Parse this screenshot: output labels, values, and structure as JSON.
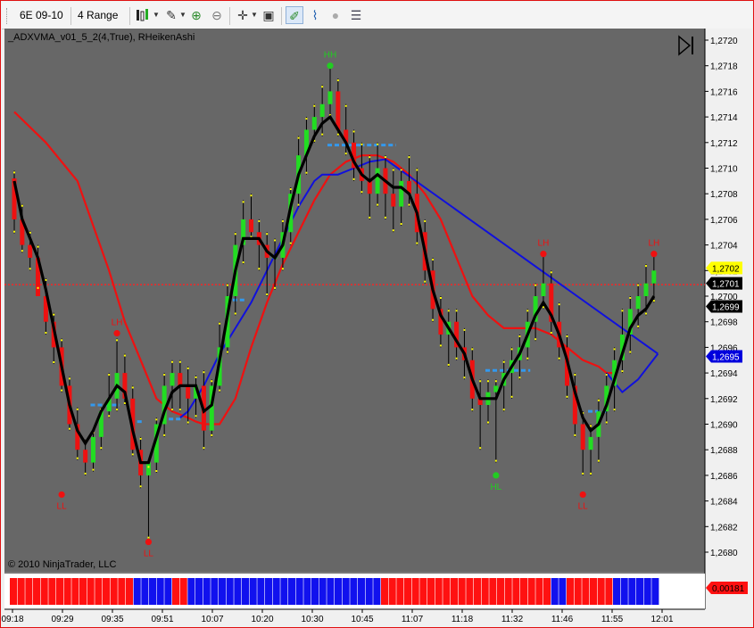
{
  "toolbar": {
    "instrument": "6E 09-10",
    "bar_type": "4 Range",
    "icons": [
      "bar-style-icon",
      "draw-tool-icon",
      "zoom-in-icon",
      "zoom-out-icon",
      "crosshair-icon",
      "properties-icon",
      "chart-trader-icon",
      "indicator-icon",
      "record-icon",
      "data-box-icon"
    ]
  },
  "chart_header": "_ADXVMA_v01_5_2(4,True), RHeikenAshi",
  "copyright": "© 2010 NinjaTrader, LLC",
  "colors": {
    "background": "#676767",
    "up_bar": "#22dd22",
    "down_bar": "#ee1111",
    "adxvma": "#000000",
    "slow_ma": "#ee1111",
    "fast_ma": "#1010dd",
    "dashes": "#3399ee",
    "reference_line": "#ff2222"
  },
  "chart_data": {
    "type": "candlestick",
    "y_axis_ticks": [
      "1,2720",
      "1,2718",
      "1,2716",
      "1,2714",
      "1,2712",
      "1,2710",
      "1,2708",
      "1,2706",
      "1,2704",
      "1,2702",
      "1,2700",
      "1,2698",
      "1,2696",
      "1,2694",
      "1,2692",
      "1,2690",
      "1,2688",
      "1,2686",
      "1,2684",
      "1,2682",
      "1,2680"
    ],
    "ylim": [
      1.2679,
      1.2721
    ],
    "x_axis_ticks": [
      "09:18",
      "09:29",
      "09:35",
      "09:51",
      "10:07",
      "10:20",
      "10:30",
      "10:45",
      "11:07",
      "11:18",
      "11:32",
      "11:46",
      "11:55",
      "12:01"
    ],
    "price_markers": [
      {
        "label": "1,2702",
        "value": 1.27022,
        "color": "#ffff00"
      },
      {
        "label": "1,2701",
        "value": 1.2701,
        "color": "#000000"
      },
      {
        "label": "1,2699",
        "value": 1.26992,
        "color": "#000000"
      },
      {
        "label": "1,2695",
        "value": 1.26953,
        "color": "#0000dd"
      }
    ],
    "reference_line": 1.27009,
    "swing_labels": [
      {
        "text": "LL",
        "bar": 6,
        "value": 1.26845,
        "color": "red",
        "pos": "below"
      },
      {
        "text": "LH",
        "bar": 13,
        "value": 1.26971,
        "color": "red",
        "pos": "above"
      },
      {
        "text": "LL",
        "bar": 17,
        "value": 1.26808,
        "color": "red",
        "pos": "below"
      },
      {
        "text": "HH",
        "bar": 40,
        "value": 1.2718,
        "color": "green",
        "pos": "above"
      },
      {
        "text": "HL",
        "bar": 61,
        "value": 1.2686,
        "color": "green",
        "pos": "below"
      },
      {
        "text": "LH",
        "bar": 67,
        "value": 1.27033,
        "color": "red",
        "pos": "above"
      },
      {
        "text": "LL",
        "bar": 72,
        "value": 1.26845,
        "color": "red",
        "pos": "below"
      },
      {
        "text": "LH",
        "bar": 81,
        "value": 1.27033,
        "color": "red",
        "pos": "above"
      }
    ],
    "candles": [
      [
        1.27092,
        1.27098,
        1.27049,
        1.2706
      ],
      [
        1.2706,
        1.27072,
        1.27034,
        1.2704
      ],
      [
        1.2704,
        1.27051,
        1.2702,
        1.2703
      ],
      [
        1.2703,
        1.2704,
        1.27005,
        1.27
      ],
      [
        1.27,
        1.27014,
        1.2697,
        1.2698
      ],
      [
        1.2698,
        1.26987,
        1.26947,
        1.2696
      ],
      [
        1.2696,
        1.26967,
        1.26925,
        1.2693
      ],
      [
        1.2693,
        1.26937,
        1.26895,
        1.269
      ],
      [
        1.269,
        1.26913,
        1.26872,
        1.2688
      ],
      [
        1.2688,
        1.26888,
        1.2686,
        1.2687
      ],
      [
        1.2687,
        1.26895,
        1.26863,
        1.2689
      ],
      [
        1.2689,
        1.26913,
        1.2688,
        1.2691
      ],
      [
        1.2691,
        1.2694,
        1.26905,
        1.2692
      ],
      [
        1.2692,
        1.26967,
        1.2691,
        1.2694
      ],
      [
        1.2694,
        1.26955,
        1.26915,
        1.2692
      ],
      [
        1.2692,
        1.2693,
        1.26875,
        1.2688
      ],
      [
        1.2688,
        1.2689,
        1.2685,
        1.2686
      ],
      [
        1.2686,
        1.26868,
        1.2681,
        1.2687
      ],
      [
        1.2687,
        1.26905,
        1.26862,
        1.269
      ],
      [
        1.269,
        1.2694,
        1.2689,
        1.2693
      ],
      [
        1.2693,
        1.2695,
        1.2691,
        1.2694
      ],
      [
        1.2694,
        1.2695,
        1.2691,
        1.2693
      ],
      [
        1.2693,
        1.26945,
        1.269,
        1.2692
      ],
      [
        1.2692,
        1.26938,
        1.26905,
        1.2693
      ],
      [
        1.2693,
        1.26942,
        1.2688,
        1.26895
      ],
      [
        1.26895,
        1.26935,
        1.2689,
        1.2693
      ],
      [
        1.2693,
        1.2698,
        1.26925,
        1.2696
      ],
      [
        1.2696,
        1.2701,
        1.26955,
        1.27
      ],
      [
        1.27,
        1.2705,
        1.26985,
        1.2704
      ],
      [
        1.2704,
        1.27075,
        1.27025,
        1.2706
      ],
      [
        1.2706,
        1.2708,
        1.27045,
        1.2705
      ],
      [
        1.2705,
        1.2706,
        1.2702,
        1.2704
      ],
      [
        1.2704,
        1.2705,
        1.27,
        1.2703
      ],
      [
        1.2703,
        1.27045,
        1.27005,
        1.2703
      ],
      [
        1.2703,
        1.2706,
        1.2702,
        1.2705
      ],
      [
        1.2705,
        1.27085,
        1.2704,
        1.2708
      ],
      [
        1.2708,
        1.27125,
        1.2707,
        1.2711
      ],
      [
        1.2711,
        1.2714,
        1.27095,
        1.2713
      ],
      [
        1.2713,
        1.2715,
        1.2712,
        1.2714
      ],
      [
        1.2714,
        1.27165,
        1.27125,
        1.2715
      ],
      [
        1.2715,
        1.2718,
        1.2714,
        1.2716
      ],
      [
        1.2716,
        1.2717,
        1.27125,
        1.2713
      ],
      [
        1.2713,
        1.2715,
        1.2711,
        1.2712
      ],
      [
        1.2712,
        1.2713,
        1.2709,
        1.271
      ],
      [
        1.271,
        1.2712,
        1.2708,
        1.2709
      ],
      [
        1.2709,
        1.2711,
        1.2706,
        1.2708
      ],
      [
        1.2708,
        1.2712,
        1.2707,
        1.271
      ],
      [
        1.271,
        1.2711,
        1.2706,
        1.2708
      ],
      [
        1.2708,
        1.271,
        1.2705,
        1.2707
      ],
      [
        1.2707,
        1.271,
        1.27055,
        1.2709
      ],
      [
        1.2709,
        1.2711,
        1.2707,
        1.2708
      ],
      [
        1.2708,
        1.271,
        1.2704,
        1.2705
      ],
      [
        1.2705,
        1.2706,
        1.2701,
        1.2702
      ],
      [
        1.2702,
        1.2703,
        1.2698,
        1.2699
      ],
      [
        1.2699,
        1.27,
        1.2696,
        1.2697
      ],
      [
        1.2697,
        1.2699,
        1.26945,
        1.2698
      ],
      [
        1.2698,
        1.2699,
        1.2695,
        1.2696
      ],
      [
        1.2696,
        1.26975,
        1.26935,
        1.2695
      ],
      [
        1.2695,
        1.2696,
        1.2691,
        1.2692
      ],
      [
        1.2692,
        1.26935,
        1.2688,
        1.26915
      ],
      [
        1.26915,
        1.26935,
        1.269,
        1.26925
      ],
      [
        1.26925,
        1.26935,
        1.2687,
        1.2693
      ],
      [
        1.2693,
        1.2695,
        1.2691,
        1.2694
      ],
      [
        1.2694,
        1.2696,
        1.2692,
        1.2695
      ],
      [
        1.2695,
        1.2697,
        1.26935,
        1.2696
      ],
      [
        1.2696,
        1.2699,
        1.2695,
        1.2698
      ],
      [
        1.2698,
        1.2701,
        1.26965,
        1.27
      ],
      [
        1.27,
        1.27033,
        1.2699,
        1.2701
      ],
      [
        1.2701,
        1.2702,
        1.2697,
        1.2698
      ],
      [
        1.2698,
        1.26995,
        1.2695,
        1.2696
      ],
      [
        1.2696,
        1.2697,
        1.2692,
        1.2693
      ],
      [
        1.2693,
        1.2694,
        1.2689,
        1.269
      ],
      [
        1.269,
        1.2691,
        1.2686,
        1.2688
      ],
      [
        1.2688,
        1.269,
        1.2686,
        1.2689
      ],
      [
        1.2689,
        1.2692,
        1.2687,
        1.2691
      ],
      [
        1.2691,
        1.2694,
        1.269,
        1.2693
      ],
      [
        1.2693,
        1.2696,
        1.2691,
        1.2695
      ],
      [
        1.2695,
        1.2699,
        1.2694,
        1.2697
      ],
      [
        1.2697,
        1.27,
        1.26955,
        1.2699
      ],
      [
        1.2699,
        1.2701,
        1.26975,
        1.27
      ],
      [
        1.27,
        1.27025,
        1.26985,
        1.2701
      ],
      [
        1.2701,
        1.27033,
        1.26995,
        1.2702
      ]
    ],
    "adxvma": [
      1.2709,
      1.2706,
      1.27045,
      1.2703,
      1.27005,
      1.26975,
      1.26945,
      1.26915,
      1.26895,
      1.26885,
      1.26895,
      1.2691,
      1.2692,
      1.2693,
      1.26925,
      1.26895,
      1.2687,
      1.2687,
      1.2689,
      1.2691,
      1.26925,
      1.2693,
      1.2693,
      1.2693,
      1.2691,
      1.26915,
      1.2695,
      1.26985,
      1.2702,
      1.27045,
      1.27045,
      1.27045,
      1.27035,
      1.2703,
      1.2704,
      1.2707,
      1.27095,
      1.2711,
      1.27125,
      1.27135,
      1.2714,
      1.2713,
      1.2712,
      1.27105,
      1.27095,
      1.2709,
      1.27095,
      1.2709,
      1.27085,
      1.27085,
      1.2708,
      1.27065,
      1.27035,
      1.27005,
      1.26985,
      1.26975,
      1.26965,
      1.26955,
      1.26935,
      1.2692,
      1.2692,
      1.2692,
      1.26935,
      1.26945,
      1.26955,
      1.2697,
      1.26985,
      1.26995,
      1.26985,
      1.2697,
      1.2695,
      1.26925,
      1.26905,
      1.26895,
      1.269,
      1.26915,
      1.26935,
      1.26955,
      1.26975,
      1.26985,
      1.2699,
      1.27
    ],
    "slow_ma": [
      [
        0,
        1.27144
      ],
      [
        4,
        1.2712
      ],
      [
        8,
        1.2709
      ],
      [
        12,
        1.2702
      ],
      [
        14,
        1.2698
      ],
      [
        16,
        1.2695
      ],
      [
        18,
        1.2692
      ],
      [
        20,
        1.2691
      ],
      [
        22,
        1.26905
      ],
      [
        23,
        1.26902
      ],
      [
        24,
        1.269
      ],
      [
        26,
        1.269
      ],
      [
        28,
        1.2692
      ],
      [
        30,
        1.2696
      ],
      [
        32,
        1.26995
      ],
      [
        34,
        1.27025
      ],
      [
        36,
        1.2705
      ],
      [
        38,
        1.27075
      ],
      [
        40,
        1.27095
      ],
      [
        42,
        1.27105
      ],
      [
        44,
        1.2711
      ],
      [
        46,
        1.2711
      ],
      [
        48,
        1.27105
      ],
      [
        50,
        1.27095
      ],
      [
        52,
        1.2708
      ],
      [
        54,
        1.2706
      ],
      [
        56,
        1.2703
      ],
      [
        58,
        1.27
      ],
      [
        60,
        1.26985
      ],
      [
        62,
        1.26975
      ],
      [
        64,
        1.26975
      ],
      [
        66,
        1.26975
      ],
      [
        68,
        1.2697
      ],
      [
        70,
        1.2696
      ],
      [
        72,
        1.2695
      ],
      [
        74,
        1.26945
      ],
      [
        75,
        1.2694
      ],
      [
        76,
        1.2694
      ]
    ],
    "fast_ma": [
      [
        21,
        1.26905
      ],
      [
        22,
        1.2691
      ],
      [
        24,
        1.2693
      ],
      [
        26,
        1.26955
      ],
      [
        28,
        1.26975
      ],
      [
        30,
        1.26995
      ],
      [
        32,
        1.2702
      ],
      [
        34,
        1.27045
      ],
      [
        36,
        1.2707
      ],
      [
        38,
        1.2709
      ],
      [
        39,
        1.27095
      ],
      [
        41,
        1.27095
      ],
      [
        43,
        1.271
      ],
      [
        45,
        1.27105
      ],
      [
        47,
        1.27107
      ]
    ],
    "dash_segments": [
      [
        10,
        13,
        1.26915
      ],
      [
        15,
        16,
        1.26902
      ],
      [
        19,
        21,
        1.26904
      ],
      [
        28,
        29,
        1.26997
      ],
      [
        40,
        44,
        1.27118
      ],
      [
        45,
        48,
        1.27118
      ],
      [
        60,
        65,
        1.26942
      ],
      [
        73,
        75,
        1.2691
      ]
    ],
    "bottom_histogram": {
      "label": "0,00181",
      "colors": [
        "r",
        "r",
        "r",
        "r",
        "r",
        "r",
        "r",
        "r",
        "r",
        "r",
        "r",
        "r",
        "r",
        "r",
        "r",
        "r",
        "b",
        "b",
        "b",
        "b",
        "b",
        "r",
        "r",
        "b",
        "b",
        "b",
        "b",
        "b",
        "b",
        "b",
        "b",
        "b",
        "b",
        "b",
        "b",
        "b",
        "b",
        "b",
        "b",
        "b",
        "b",
        "b",
        "b",
        "b",
        "b",
        "b",
        "b",
        "b",
        "r",
        "r",
        "r",
        "r",
        "r",
        "r",
        "r",
        "r",
        "r",
        "r",
        "r",
        "r",
        "r",
        "r",
        "r",
        "r",
        "r",
        "r",
        "r",
        "r",
        "r",
        "r",
        "b",
        "b",
        "r",
        "r",
        "r",
        "r",
        "r",
        "r",
        "b",
        "b",
        "b",
        "b",
        "b",
        "b"
      ]
    }
  }
}
